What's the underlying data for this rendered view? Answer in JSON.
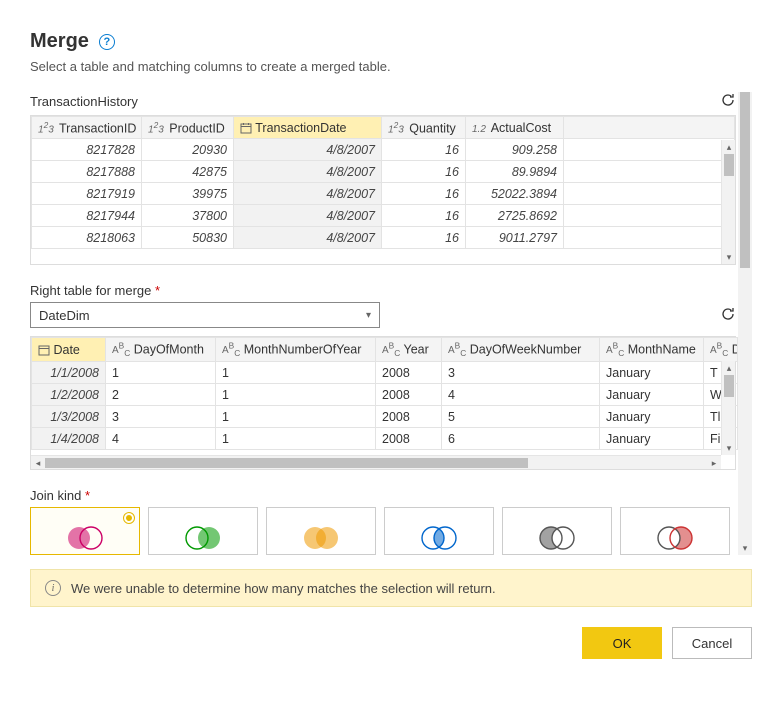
{
  "header": {
    "title": "Merge",
    "subtitle": "Select a table and matching columns to create a merged table."
  },
  "table1": {
    "name": "TransactionHistory",
    "columns": [
      {
        "label": "TransactionID",
        "type": "int"
      },
      {
        "label": "ProductID",
        "type": "int"
      },
      {
        "label": "TransactionDate",
        "type": "date",
        "selected": true
      },
      {
        "label": "Quantity",
        "type": "int"
      },
      {
        "label": "ActualCost",
        "type": "decimal"
      }
    ],
    "rows": [
      {
        "TransactionID": "8217828",
        "ProductID": "20930",
        "TransactionDate": "4/8/2007",
        "Quantity": "16",
        "ActualCost": "909.258"
      },
      {
        "TransactionID": "8217888",
        "ProductID": "42875",
        "TransactionDate": "4/8/2007",
        "Quantity": "16",
        "ActualCost": "89.9894"
      },
      {
        "TransactionID": "8217919",
        "ProductID": "39975",
        "TransactionDate": "4/8/2007",
        "Quantity": "16",
        "ActualCost": "52022.3894"
      },
      {
        "TransactionID": "8217944",
        "ProductID": "37800",
        "TransactionDate": "4/8/2007",
        "Quantity": "16",
        "ActualCost": "2725.8692"
      },
      {
        "TransactionID": "8218063",
        "ProductID": "50830",
        "TransactionDate": "4/8/2007",
        "Quantity": "16",
        "ActualCost": "9011.2797"
      }
    ]
  },
  "right_table": {
    "label": "Right table for merge",
    "selected": "DateDim"
  },
  "table2": {
    "columns": [
      {
        "label": "Date",
        "type": "date",
        "selected": true
      },
      {
        "label": "DayOfMonth",
        "type": "text"
      },
      {
        "label": "MonthNumberOfYear",
        "type": "text"
      },
      {
        "label": "Year",
        "type": "text"
      },
      {
        "label": "DayOfWeekNumber",
        "type": "text"
      },
      {
        "label": "MonthName",
        "type": "text"
      },
      {
        "label": "D",
        "type": "text"
      }
    ],
    "rows": [
      {
        "Date": "1/1/2008",
        "DayOfMonth": "1",
        "MonthNumberOfYear": "1",
        "Year": "2008",
        "DayOfWeekNumber": "3",
        "MonthName": "January",
        "D": "T"
      },
      {
        "Date": "1/2/2008",
        "DayOfMonth": "2",
        "MonthNumberOfYear": "1",
        "Year": "2008",
        "DayOfWeekNumber": "4",
        "MonthName": "January",
        "D": "W"
      },
      {
        "Date": "1/3/2008",
        "DayOfMonth": "3",
        "MonthNumberOfYear": "1",
        "Year": "2008",
        "DayOfWeekNumber": "5",
        "MonthName": "January",
        "D": "Tl"
      },
      {
        "Date": "1/4/2008",
        "DayOfMonth": "4",
        "MonthNumberOfYear": "1",
        "Year": "2008",
        "DayOfWeekNumber": "6",
        "MonthName": "January",
        "D": "Fi"
      }
    ]
  },
  "join": {
    "label": "Join kind",
    "options": [
      "left-outer",
      "right-outer",
      "full-outer",
      "inner",
      "left-anti",
      "right-anti"
    ],
    "selected": 0
  },
  "warning": "We were unable to determine how many matches the selection will return.",
  "buttons": {
    "ok": "OK",
    "cancel": "Cancel"
  }
}
